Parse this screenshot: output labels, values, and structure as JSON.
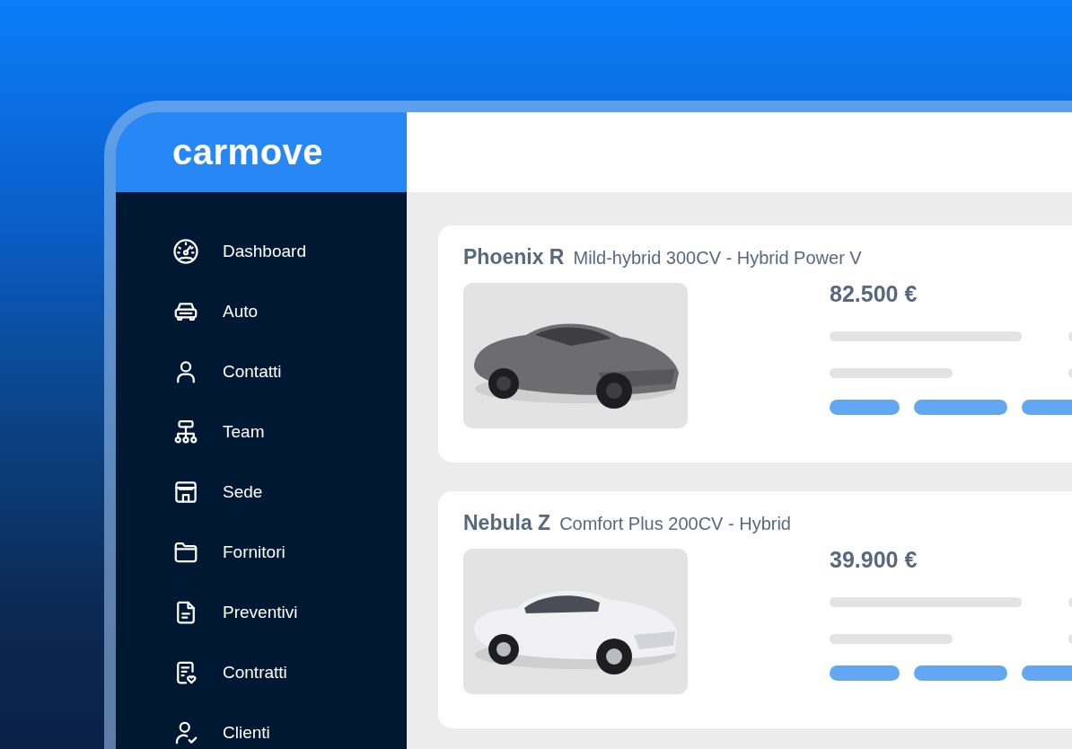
{
  "brand": {
    "logo": "carmove"
  },
  "sidebar": {
    "items": [
      {
        "label": "Dashboard"
      },
      {
        "label": "Auto"
      },
      {
        "label": "Contatti"
      },
      {
        "label": "Team"
      },
      {
        "label": "Sede"
      },
      {
        "label": "Fornitori"
      },
      {
        "label": "Preventivi"
      },
      {
        "label": "Contratti"
      },
      {
        "label": "Clienti"
      }
    ]
  },
  "listings": [
    {
      "model": "Phoenix R",
      "trim": "Mild-hybrid 300CV - Hybrid Power V",
      "price": "82.500 €"
    },
    {
      "model": "Nebula Z",
      "trim": "Comfort Plus 200CV - Hybrid",
      "price": "39.900 €"
    }
  ]
}
